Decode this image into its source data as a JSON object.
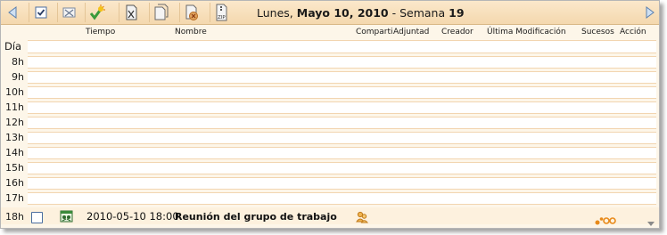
{
  "toolbar": {
    "prev_icon": "triangle-left-icon",
    "next_icon": "triangle-right-icon",
    "buttons": [
      {
        "icon": "checkbox-check-icon"
      },
      {
        "icon": "envelope-x-icon"
      },
      {
        "icon": "new-event-sparkle-check-icon"
      },
      {
        "icon": "copy-move-icon"
      },
      {
        "icon": "duplicate-document-icon"
      },
      {
        "icon": "delete-document-icon"
      },
      {
        "icon": "zip-archive-icon"
      }
    ],
    "date_prefix": "Lunes,",
    "date_bold": "Mayo 10, 2010",
    "week_prefix": "- Semana",
    "week_number": "19"
  },
  "columns": {
    "tiempo": "Tiempo",
    "nombre": "Nombre",
    "compartido": "Comparti",
    "adjuntado": "Adjuntad",
    "creador": "Creador",
    "ultima_modificacion": "Última Modificación",
    "sucesos": "Sucesos",
    "accion": "Acción"
  },
  "day_label": "Día",
  "hours": [
    "8h",
    "9h",
    "10h",
    "11h",
    "12h",
    "13h",
    "14h",
    "15h",
    "16h",
    "17h"
  ],
  "event": {
    "hour": "18h",
    "type_icon": "group-meeting-icon",
    "time": "2010-05-10 18:00",
    "name": "Reunión del grupo de trabajo",
    "shared_icon": "shared-people-icon",
    "action_icon": "actions-gear-icon",
    "more_icon": "chevron-down-icon"
  },
  "colors": {
    "toolbar_top": "#fbe8cb",
    "toolbar_bottom": "#f4d8ae",
    "background": "#fdf6e9",
    "slot_border": "#f2d5b0",
    "icon_orange": "#e88a1a"
  }
}
